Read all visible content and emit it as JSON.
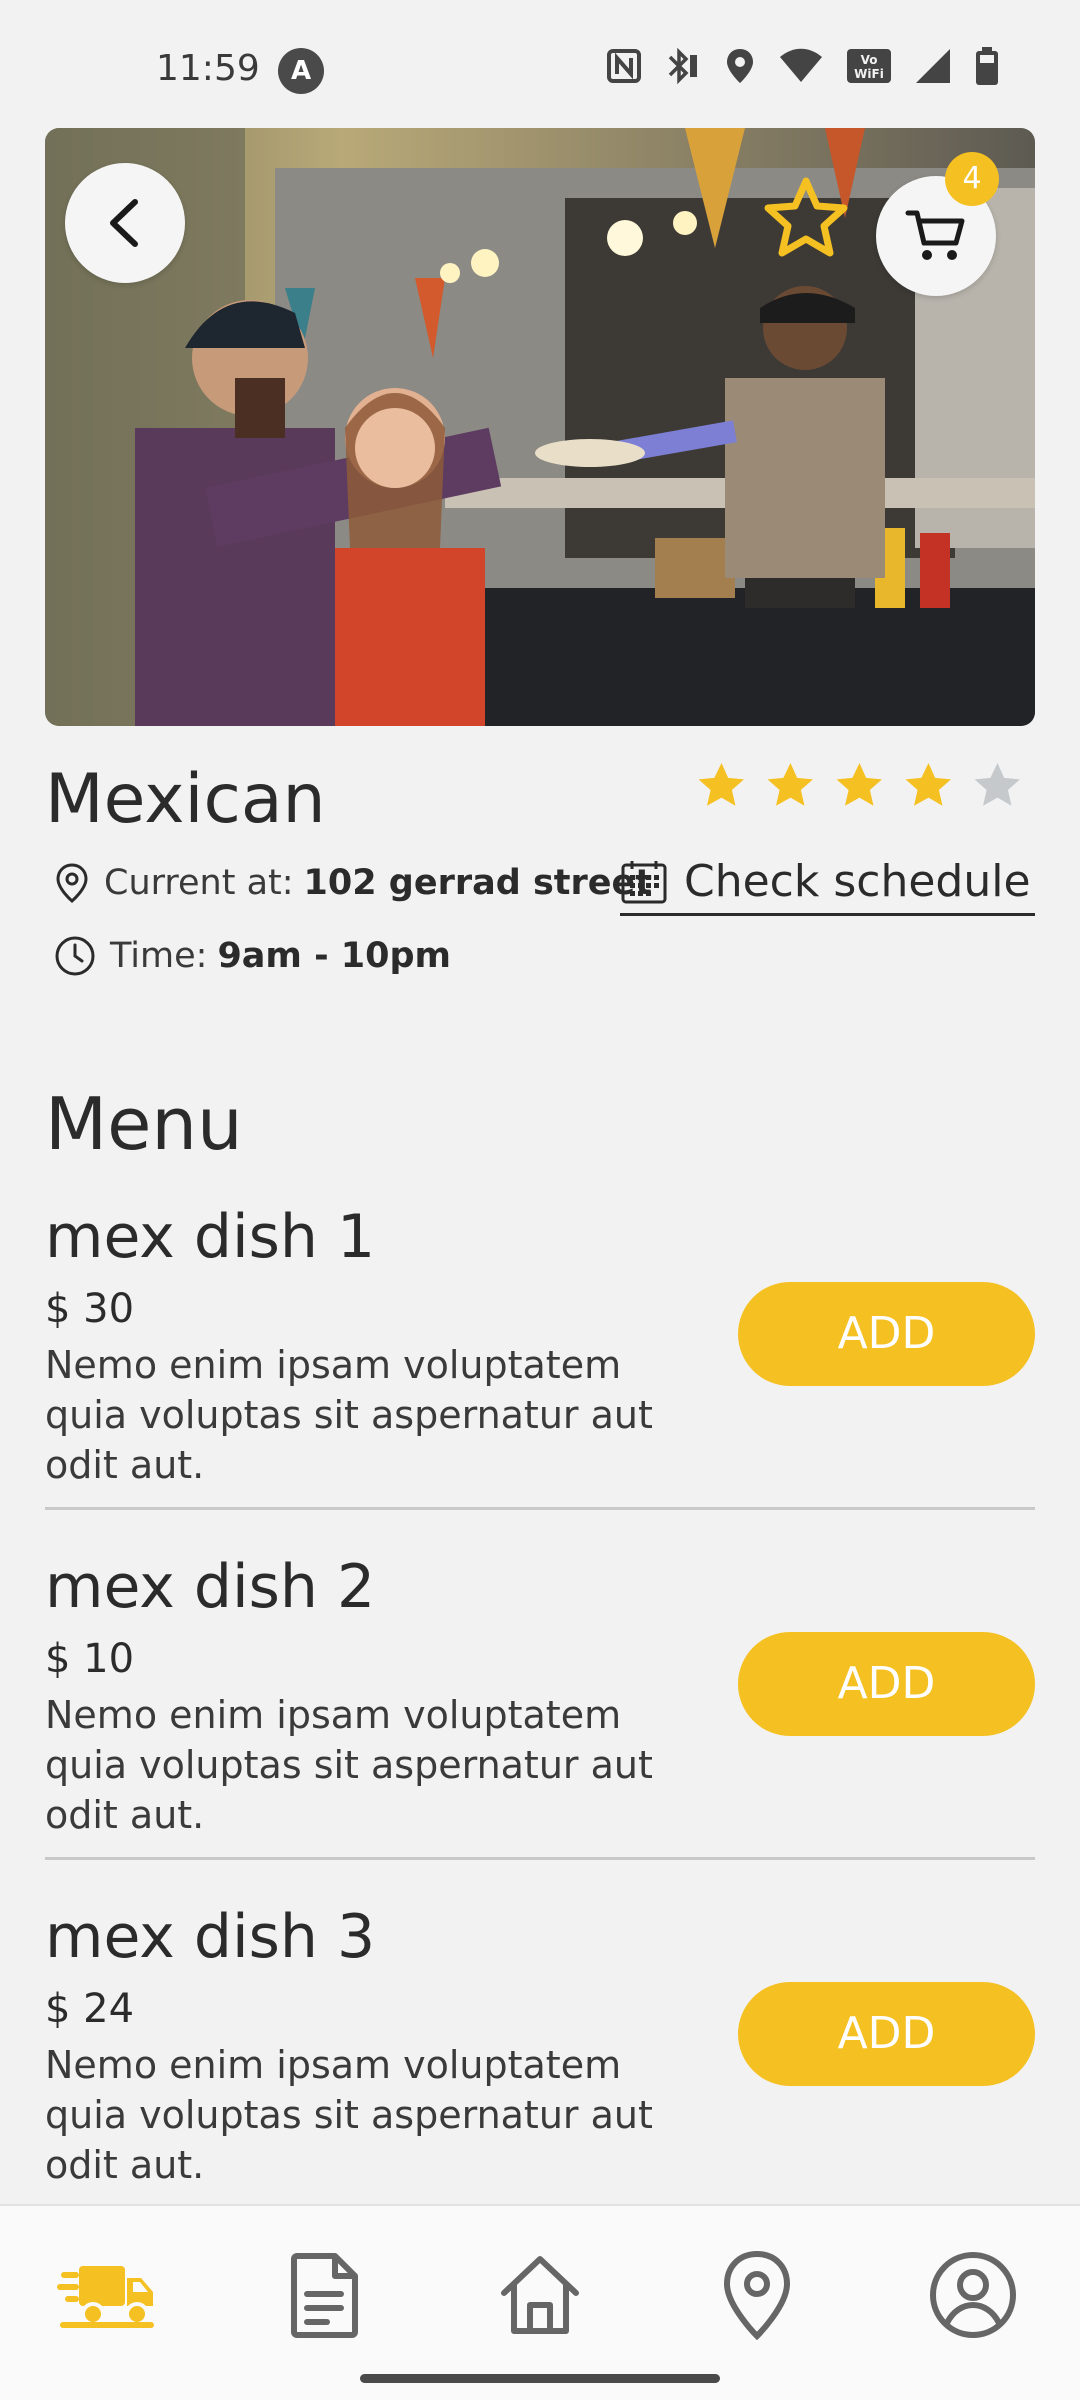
{
  "status_bar": {
    "time": "11:59",
    "badge": "A",
    "icons": [
      "nfc-icon",
      "bluetooth-icon",
      "location-icon",
      "wifi-icon",
      "vowifi-icon",
      "signal-icon",
      "battery-icon"
    ]
  },
  "hero": {
    "back_icon": "chevron-left-icon",
    "favorite_icon": "star-outline-icon",
    "cart_icon": "cart-icon",
    "cart_count": "4"
  },
  "truck": {
    "name": "Mexican",
    "rating": 4,
    "rating_max": 5,
    "location_label": "Current at:",
    "location_value": "102 gerrad street",
    "schedule_label": "Check schedule",
    "time_label": "Time:",
    "time_value": "9am - 10pm"
  },
  "menu": {
    "heading": "Menu",
    "items": [
      {
        "name": "mex dish 1",
        "price": "$ 30",
        "description": "Nemo enim ipsam voluptatem quia voluptas sit aspernatur aut odit aut.",
        "button": "ADD"
      },
      {
        "name": "mex dish 2",
        "price": "$ 10",
        "description": "Nemo enim ipsam voluptatem quia voluptas sit aspernatur aut odit aut.",
        "button": "ADD"
      },
      {
        "name": "mex dish 3",
        "price": "$ 24",
        "description": "Nemo enim ipsam voluptatem quia voluptas sit aspernatur aut odit aut.",
        "button": "ADD"
      }
    ]
  },
  "bottom_nav": {
    "items": [
      "truck-icon",
      "document-icon",
      "home-icon",
      "location-pin-icon",
      "profile-icon"
    ],
    "active": "truck-icon"
  },
  "colors": {
    "accent": "#f5c022",
    "background": "#f2f2f2",
    "text": "#2b2b2b",
    "star_inactive": "#c5c9cc"
  }
}
